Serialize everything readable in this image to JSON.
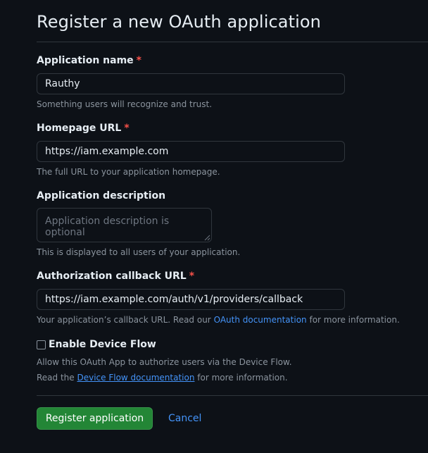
{
  "page": {
    "title": "Register a new OAuth application"
  },
  "form": {
    "app_name": {
      "label": "Application name",
      "required_marker": "*",
      "value": "Rauthy",
      "hint": "Something users will recognize and trust."
    },
    "homepage_url": {
      "label": "Homepage URL",
      "required_marker": "*",
      "value": "https://iam.example.com",
      "hint": "The full URL to your application homepage."
    },
    "description": {
      "label": "Application description",
      "placeholder": "Application description is optional",
      "hint": "This is displayed to all users of your application."
    },
    "callback_url": {
      "label": "Authorization callback URL",
      "required_marker": "*",
      "value": "https://iam.example.com/auth/v1/providers/callback",
      "hint_before": "Your application’s callback URL. Read our",
      "hint_link": "OAuth documentation",
      "hint_after": "for more information."
    },
    "device_flow": {
      "label": "Enable Device Flow",
      "checked": false,
      "hint_line1": "Allow this OAuth App to authorize users via the Device Flow.",
      "hint2_before": "Read the",
      "hint2_link": "Device Flow documentation",
      "hint2_after": "for more information."
    }
  },
  "actions": {
    "register_label": "Register application",
    "cancel_label": "Cancel"
  },
  "colors": {
    "background": "#0d1117",
    "primary_button": "#238636",
    "link": "#4493f8",
    "required": "#f85149",
    "muted_text": "#8b949e",
    "border": "#30363d"
  }
}
